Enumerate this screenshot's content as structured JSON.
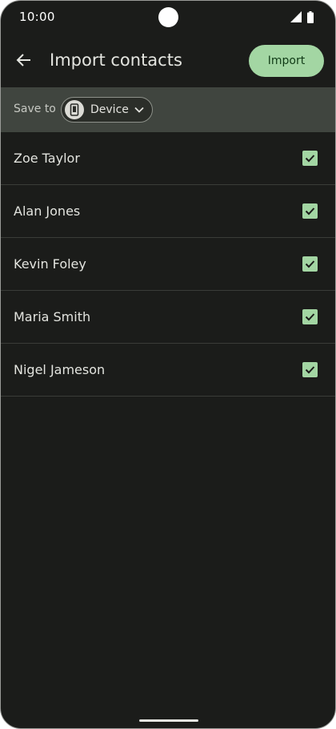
{
  "status_bar": {
    "time": "10:00"
  },
  "app_bar": {
    "title": "Import contacts",
    "import_label": "Import"
  },
  "save_bar": {
    "label": "Save to",
    "selected_destination": "Device"
  },
  "contacts": [
    {
      "name": "Zoe Taylor",
      "checked": true
    },
    {
      "name": "Alan Jones",
      "checked": true
    },
    {
      "name": "Kevin Foley",
      "checked": true
    },
    {
      "name": "Maria Smith",
      "checked": true
    },
    {
      "name": "Nigel Jameson",
      "checked": true
    }
  ],
  "icons": {
    "back": "arrow-back-icon",
    "device": "phone-icon",
    "dropdown": "chevron-down-icon",
    "checkbox": "check-icon"
  },
  "colors": {
    "background": "#1b1c1a",
    "accent": "#a3d6a3",
    "accent_text": "#103a16",
    "save_bar": "#40453f"
  }
}
